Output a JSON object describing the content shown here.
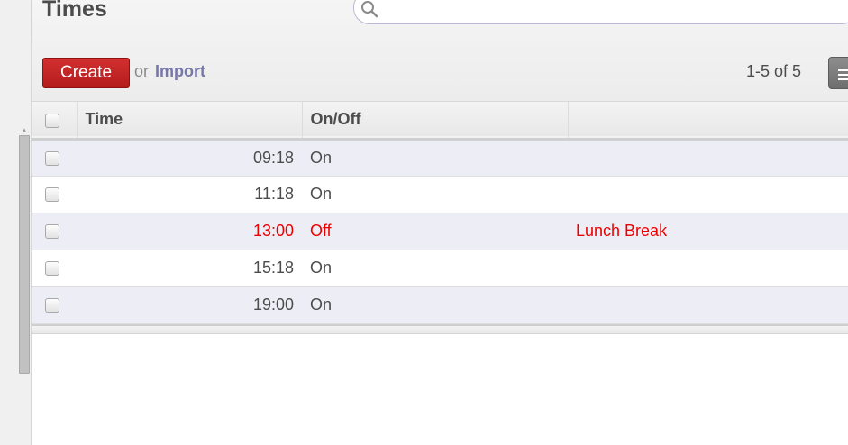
{
  "header": {
    "title": "Times",
    "search": {
      "placeholder": "",
      "value": ""
    },
    "create_label": "Create",
    "or_label": "or",
    "import_label": "Import",
    "pager": "1-5 of 5"
  },
  "table": {
    "columns": [
      "Time",
      "On/Off",
      ""
    ],
    "rows": [
      {
        "time": "09:18",
        "state": "On",
        "note": ""
      },
      {
        "time": "11:18",
        "state": "On",
        "note": ""
      },
      {
        "time": "13:00",
        "state": "Off",
        "note": "Lunch Break"
      },
      {
        "time": "15:18",
        "state": "On",
        "note": ""
      },
      {
        "time": "19:00",
        "state": "On",
        "note": ""
      }
    ]
  },
  "colors": {
    "accent_red": "#d33030",
    "off_text": "#ee0000",
    "link": "#7777aa",
    "row_stripe": "#ededf6"
  },
  "icons": {
    "search": "search-icon",
    "list_view": "list-view-icon"
  }
}
